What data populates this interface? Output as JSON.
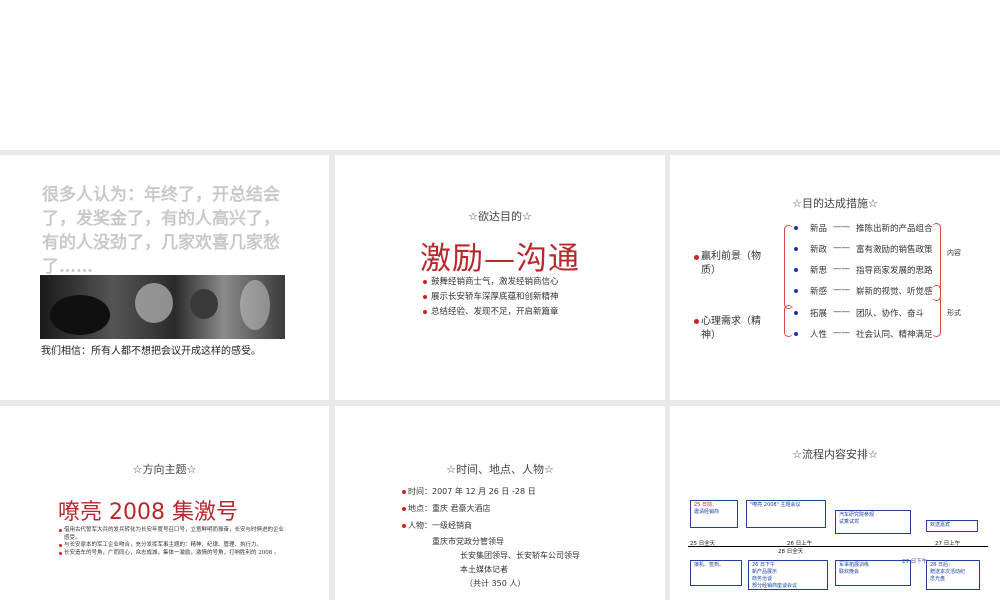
{
  "slide1": {
    "quote": "很多人认为：年终了，开总结会了，发奖金了，有的人高兴了，有的人没劲了，几家欢喜几家愁了……",
    "caption": "我们相信：所有人都不想把会议开成这样的感受。"
  },
  "slide2": {
    "title": "☆欲达目的☆",
    "main": "激励—沟通",
    "bullets": [
      "鼓舞经销商士气，激发经销商信心",
      "展示长安轿车深厚底蕴和创新精神",
      "总结经验、发现不足，开启新篇章"
    ]
  },
  "slide3": {
    "title": "☆目的达成措施☆",
    "group1_label": "赢利前景（物质）",
    "group2_label": "心理需求（精神）",
    "items": [
      {
        "key": "新品",
        "desc": "推陈出新的产品组合"
      },
      {
        "key": "新政",
        "desc": "富有激励的销售政策"
      },
      {
        "key": "新思",
        "desc": "指导商家发展的思路"
      },
      {
        "key": "新感",
        "desc": "崭新的视觉、听觉感"
      },
      {
        "key": "拓展",
        "desc": "团队、协作、奋斗"
      },
      {
        "key": "人性",
        "desc": "社会认同、精神满足"
      }
    ],
    "dash": "——",
    "content_label": "内容",
    "form_label": "形式"
  },
  "slide4": {
    "title": "☆方向主题☆",
    "main": "嘹亮 2008   集激号",
    "bullets": [
      "借用古代誓军大兵的发兵转化为长安年度号召口号，立意鲜明而振奋，长安与时俱进的企业感受。",
      "与长安原本的军工企业吻合，充分发挥军事主题的：精神、纪律、管理、执行力。",
      "长安造车的号角，广而同心，众志成城，集体一激励，激情的号角，打响胜利的 2008 。"
    ]
  },
  "slide5": {
    "title": "☆时间、地点、人物☆",
    "time": "时间：2007 年 12 月 26 日 -28 日",
    "place": "地点：重庆    君豪大酒店",
    "people_label": "人物：一级经销商",
    "people_lines": [
      "重庆市党政分管领导",
      "长安集团领导、长安轿车公司领导",
      "本土媒体记者",
      "（共计 350 人）"
    ]
  },
  "slide6": {
    "title": "☆流程内容安排☆",
    "box1": [
      "25 日前：",
      "邀请经销商"
    ],
    "box2": [
      "\"嘹亮 2008\" 主题会议"
    ],
    "box3": [
      "汽车研究院参观",
      "试乘试驾"
    ],
    "box4": [
      "欢送嘉宾"
    ],
    "timeline_labels": [
      "25 日全天",
      "26 日上午",
      "28 日全天",
      "27 日上午"
    ],
    "box5": [
      "接机、签到。"
    ],
    "box6": [
      "26 日下午",
      "新产品展示",
      "商务治谈",
      "部分经销商座谈会议"
    ],
    "box7": [
      "军事拓展训练",
      "联欢晚会"
    ],
    "box8_time": "27 日下午",
    "box8": [
      "28 日后：",
      "赠送本次活动纪",
      "念光盘"
    ]
  },
  "colors": {
    "accent_red": "#b8282c",
    "timeline_blue": "#2040a0"
  }
}
